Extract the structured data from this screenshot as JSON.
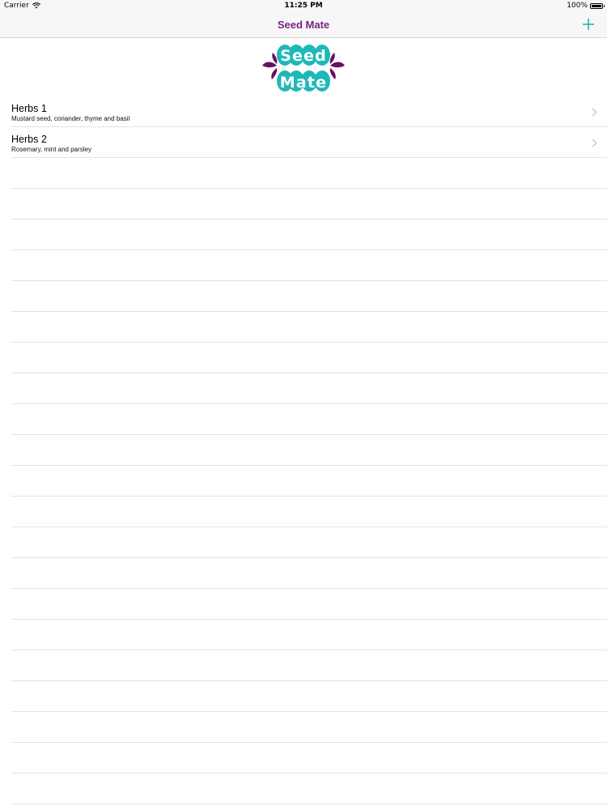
{
  "status_bar": {
    "carrier": "Carrier",
    "time": "11:25 PM",
    "battery": "100%",
    "battery_level": 1.0
  },
  "nav": {
    "title": "Seed Mate",
    "add_icon": "plus-icon",
    "accent_color": "#2bb5a0",
    "title_color": "#7b1f7f"
  },
  "logo": {
    "line1": "Seed",
    "line2": "Mate",
    "seed_color": "#1fb8b8",
    "leaf_color": "#6b0f63"
  },
  "rows": [
    {
      "title": "Herbs 1",
      "subtitle": "Mustard seed, coriander, thyme and basil"
    },
    {
      "title": "Herbs 2",
      "subtitle": "Rosemary, mint and parsley"
    }
  ],
  "empty_rows": 21
}
